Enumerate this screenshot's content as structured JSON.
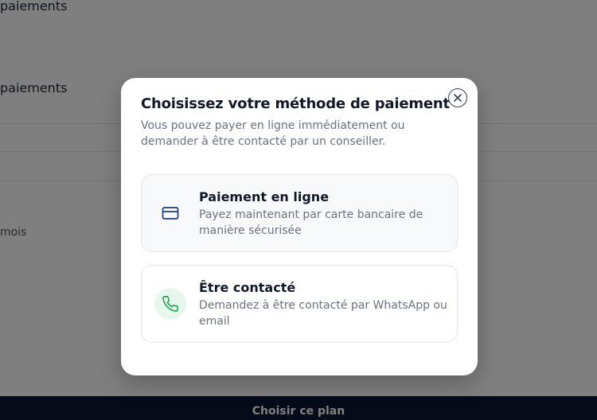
{
  "background": {
    "section_label_1": "paiements",
    "section_label_2": "paiements",
    "duration_text": "mois",
    "cta_label": "Choisir ce plan"
  },
  "modal": {
    "title": "Choisissez votre méthode de paiement",
    "description": "Vous pouvez payer en ligne immédiatement ou demander à être contacté par un conseiller.",
    "close_icon": "close-icon",
    "options": [
      {
        "icon": "credit-card-icon",
        "title": "Paiement en ligne",
        "description": "Payez maintenant par carte bancaire de manière sécurisée",
        "icon_color": "#1e3a8a"
      },
      {
        "icon": "phone-icon",
        "title": "Être contacté",
        "description": "Demandez à être contacté par WhatsApp ou email",
        "icon_color": "#16a34a"
      }
    ]
  }
}
